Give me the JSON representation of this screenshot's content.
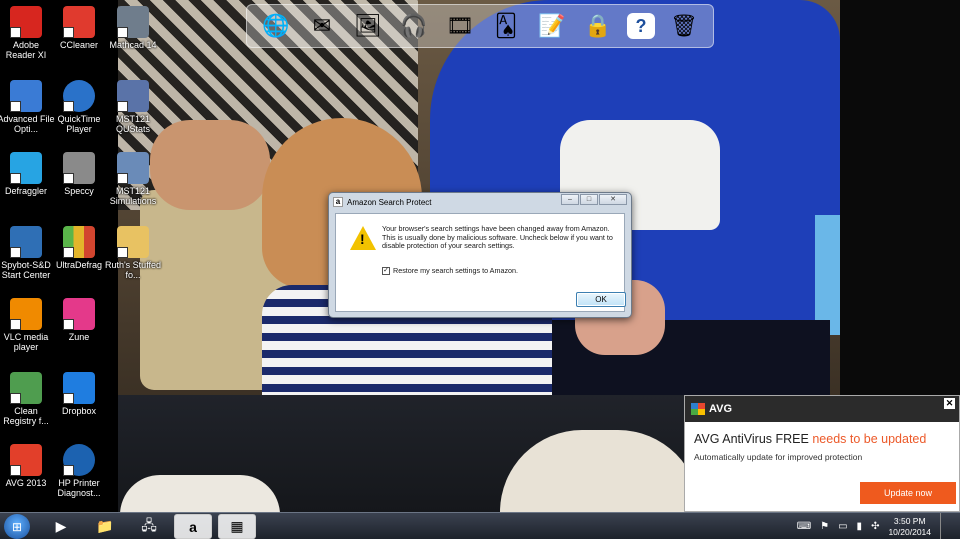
{
  "desktop_icons": [
    {
      "label": "Adobe Reader XI",
      "icon": "adobe-reader-icon",
      "color": "#d7261f"
    },
    {
      "label": "Advanced File Opti...",
      "icon": "file-optimizer-icon",
      "color": "#3a7bd5"
    },
    {
      "label": "Defraggler",
      "icon": "defraggler-icon",
      "color": "#27a4e3"
    },
    {
      "label": "Spybot-S&D Start Center",
      "icon": "spybot-icon",
      "color": "#2f6fb5"
    },
    {
      "label": "VLC media player",
      "icon": "vlc-icon",
      "color": "#f08a00"
    },
    {
      "label": "Clean Registry f...",
      "icon": "registry-icon",
      "color": "#4f9d4f"
    },
    {
      "label": "AVG 2013",
      "icon": "avg-icon",
      "color": "#e23f2a"
    },
    {
      "label": "CCleaner",
      "icon": "ccleaner-icon",
      "color": "#e03a2e"
    },
    {
      "label": "QuickTime Player",
      "icon": "quicktime-icon",
      "color": "#2a72c9"
    },
    {
      "label": "Speccy",
      "icon": "speccy-icon",
      "color": "#8a8a8a"
    },
    {
      "label": "UltraDefrag",
      "icon": "ultradefrag-icon",
      "color": "#5ab54a"
    },
    {
      "label": "Zune",
      "icon": "zune-icon",
      "color": "#e4398a"
    },
    {
      "label": "Dropbox",
      "icon": "dropbox-icon",
      "color": "#1f7de0"
    },
    {
      "label": "HP Printer Diagnost...",
      "icon": "hp-icon",
      "color": "#1c62b0"
    },
    {
      "label": "Mathcad 14",
      "icon": "mathcad-icon",
      "color": "#6f7d8c"
    },
    {
      "label": "MST121 QUStats",
      "icon": "qustats-icon",
      "color": "#5a73a8"
    },
    {
      "label": "MST121 Simulations",
      "icon": "simulations-icon",
      "color": "#6a8bb8"
    },
    {
      "label": "Ruth's Stuffed fo...",
      "icon": "folder-icon",
      "color": "#e8c262"
    }
  ],
  "dock": [
    "globe-icon",
    "mail-icon",
    "photos-icon",
    "headphones-icon",
    "film-reel-icon",
    "cards-icon",
    "notepad-icon",
    "lock-icon",
    "help-icon",
    "recycle-bin-icon"
  ],
  "dialog": {
    "title": "Amazon Search Protect",
    "message": "Your browser's search settings have been changed away from Amazon. This is usually done by malicious software. Uncheck below if you want to disable protection of your search settings.",
    "checkbox_label": "Restore my search settings to Amazon.",
    "checkbox_checked": true,
    "ok_label": "OK"
  },
  "avg_popup": {
    "brand": "AVG",
    "headline": "AVG AntiVirus FREE",
    "headline_alert": "needs to be updated",
    "subtext": "Automatically update for improved protection",
    "button_label": "Update now",
    "accent_color": "#ef5a1e"
  },
  "taskbar": {
    "items": [
      "media-player-icon",
      "explorer-icon",
      "network-icon",
      "amazon-icon",
      "avg-icon"
    ],
    "time": "3:50 PM",
    "date": "10/20/2014"
  }
}
